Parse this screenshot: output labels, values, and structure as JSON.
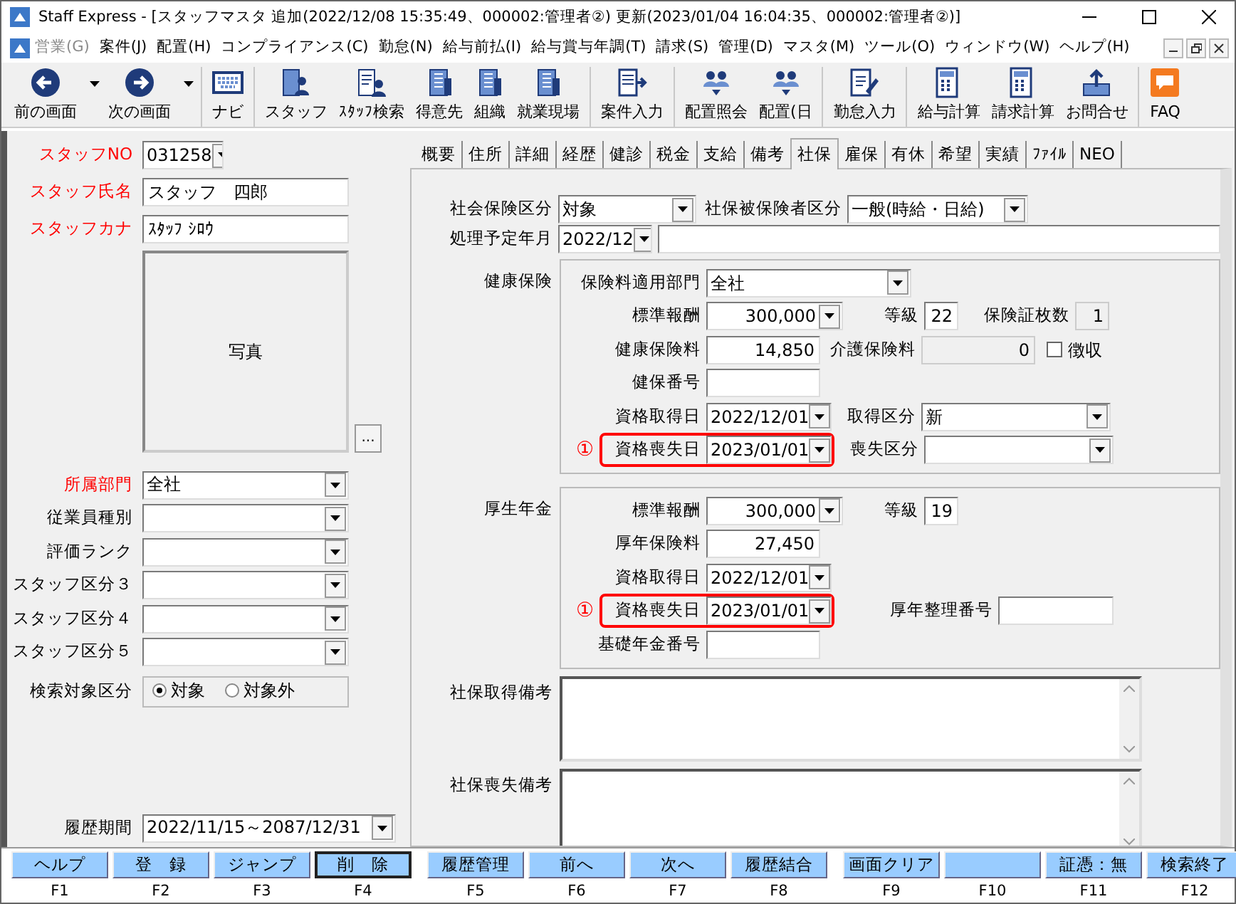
{
  "window": {
    "title": "Staff Express - [スタッフマスタ  追加(2022/12/08 15:35:49、000002:管理者②)  更新(2023/01/04 16:04:35、000002:管理者②)]"
  },
  "menu": [
    {
      "label": "営業(G)",
      "disabled": true
    },
    {
      "label": "案件(J)",
      "disabled": false
    },
    {
      "label": "配置(H)",
      "disabled": false
    },
    {
      "label": "コンプライアンス(C)",
      "disabled": false
    },
    {
      "label": "勤怠(N)",
      "disabled": false
    },
    {
      "label": "給与前払(I)",
      "disabled": false
    },
    {
      "label": "給与賞与年調(T)",
      "disabled": false
    },
    {
      "label": "請求(S)",
      "disabled": false
    },
    {
      "label": "管理(D)",
      "disabled": false
    },
    {
      "label": "マスタ(M)",
      "disabled": false
    },
    {
      "label": "ツール(O)",
      "disabled": false
    },
    {
      "label": "ウィンドウ(W)",
      "disabled": false
    },
    {
      "label": "ヘルプ(H)",
      "disabled": false
    }
  ],
  "toolbar": [
    [
      {
        "label": "前の画面",
        "dropdown": true
      },
      {
        "label": "次の画面",
        "dropdown": true
      }
    ],
    [
      {
        "label": "ナビ",
        "dropdown": false
      }
    ],
    [
      {
        "label": "スタッフ",
        "dropdown": false
      },
      {
        "label": "ｽﾀｯﾌ検索",
        "dropdown": false
      },
      {
        "label": "得意先",
        "dropdown": false
      },
      {
        "label": "組織",
        "dropdown": false
      },
      {
        "label": "就業現場",
        "dropdown": false
      }
    ],
    [
      {
        "label": "案件入力",
        "dropdown": false
      }
    ],
    [
      {
        "label": "配置照会",
        "dropdown": false
      },
      {
        "label": "配置(日",
        "dropdown": false
      }
    ],
    [
      {
        "label": "勤怠入力",
        "dropdown": false
      }
    ],
    [
      {
        "label": "給与計算",
        "dropdown": false
      },
      {
        "label": "請求計算",
        "dropdown": false
      },
      {
        "label": "お問合せ",
        "dropdown": false
      }
    ],
    [
      {
        "label": "FAQ",
        "dropdown": false
      }
    ]
  ],
  "left": {
    "fields": [
      {
        "label": "スタッフNO",
        "required": true,
        "kind": "select",
        "value": "031258"
      },
      {
        "label": "スタッフ氏名",
        "required": true,
        "kind": "text",
        "value": "スタッフ　四郎"
      },
      {
        "label": "スタッフカナ",
        "required": true,
        "kind": "text",
        "value": "ｽﾀｯﾌ ｼﾛｳ"
      }
    ],
    "photo": {
      "label": "写真",
      "button": "..."
    },
    "attributes": [
      {
        "label": "所属部門",
        "required": true,
        "kind": "select",
        "value": "全社"
      },
      {
        "label": "従業員種別",
        "required": false,
        "kind": "select"
      },
      {
        "label": "評価ランク",
        "required": false,
        "kind": "select"
      },
      {
        "label": "スタッフ区分３",
        "required": false,
        "kind": "select"
      },
      {
        "label": "スタッフ区分４",
        "required": false,
        "kind": "select"
      },
      {
        "label": "スタッフ区分５",
        "required": false,
        "kind": "select"
      }
    ],
    "search_target": {
      "label": "検索対象区分",
      "options": [
        {
          "label": "対象",
          "selected": true
        },
        {
          "label": "対象外",
          "selected": false
        }
      ]
    },
    "history": {
      "label": "履歴期間",
      "value": "2022/11/15～2087/12/31"
    }
  },
  "tabs": [
    {
      "label": "概要",
      "selected": false
    },
    {
      "label": "住所",
      "selected": false
    },
    {
      "label": "詳細",
      "selected": false
    },
    {
      "label": "経歴",
      "selected": false
    },
    {
      "label": "健診",
      "selected": false
    },
    {
      "label": "税金",
      "selected": false
    },
    {
      "label": "支給",
      "selected": false
    },
    {
      "label": "備考",
      "selected": false
    },
    {
      "label": "社保",
      "selected": true
    },
    {
      "label": "雇保",
      "selected": false
    },
    {
      "label": "有休",
      "selected": false
    },
    {
      "label": "希望",
      "selected": false
    },
    {
      "label": "実績",
      "selected": false
    },
    {
      "label": "ﾌｧｲﾙ",
      "selected": false
    },
    {
      "label": "NEO",
      "selected": false
    }
  ],
  "social": {
    "insurance_type": {
      "label": "社会保険区分",
      "value": "対象"
    },
    "insured_type": {
      "label": "社保被保険者区分",
      "value": "一般(時給・日給)"
    },
    "planned_month": {
      "label": "処理予定年月",
      "value": "2022/12"
    }
  },
  "health": {
    "title": "健康保険",
    "department": {
      "label": "保険料適用部門",
      "value": "全社"
    },
    "standard_pay": {
      "label": "標準報酬",
      "value": "300,000"
    },
    "grade": {
      "label": "等級",
      "value": "22"
    },
    "card_count": {
      "label": "保険証枚数",
      "value": "1",
      "disabled": true
    },
    "premium": {
      "label": "健康保険料",
      "value": "14,850"
    },
    "care_premium": {
      "label": "介護保険料",
      "value": "0",
      "disabled": true
    },
    "collect": {
      "label": "徴収",
      "checked": false
    },
    "number": {
      "label": "健保番号"
    },
    "acquired": {
      "label": "資格取得日",
      "value": "2022/12/01"
    },
    "acquire_type": {
      "label": "取得区分",
      "value": "新"
    },
    "lost": {
      "label": "資格喪失日",
      "value": "2023/01/01",
      "highlighted": true,
      "marker": "①"
    },
    "loss_type": {
      "label": "喪失区分"
    }
  },
  "pension": {
    "title": "厚生年金",
    "standard_pay": {
      "label": "標準報酬",
      "value": "300,000"
    },
    "grade": {
      "label": "等級",
      "value": "19"
    },
    "premium": {
      "label": "厚年保険料",
      "value": "27,450"
    },
    "acquired": {
      "label": "資格取得日",
      "value": "2022/12/01"
    },
    "lost": {
      "label": "資格喪失日",
      "value": "2023/01/01",
      "highlighted": true,
      "marker": "①"
    },
    "ref_number": {
      "label": "厚年整理番号"
    },
    "basic_number": {
      "label": "基礎年金番号"
    }
  },
  "remarks": [
    {
      "label": "社保取得備考"
    },
    {
      "label": "社保喪失備考"
    }
  ],
  "function_keys": [
    {
      "label": "ヘルプ",
      "key": "F1",
      "focused": false
    },
    {
      "label": "登　録",
      "key": "F2",
      "focused": false
    },
    {
      "label": "ジャンプ",
      "key": "F3",
      "focused": false
    },
    {
      "label": "削　除",
      "key": "F4",
      "focused": true
    },
    {
      "label": "履歴管理",
      "key": "F5",
      "focused": false
    },
    {
      "label": "前へ",
      "key": "F6",
      "focused": false
    },
    {
      "label": "次へ",
      "key": "F7",
      "focused": false
    },
    {
      "label": "履歴結合",
      "key": "F8",
      "focused": false
    },
    {
      "label": "画面クリア",
      "key": "F9",
      "focused": false
    },
    {
      "key": "F10",
      "focused": false
    },
    {
      "label": "証憑：無",
      "key": "F11",
      "focused": false
    },
    {
      "label": "検索終了",
      "key": "F12",
      "focused": false
    }
  ]
}
